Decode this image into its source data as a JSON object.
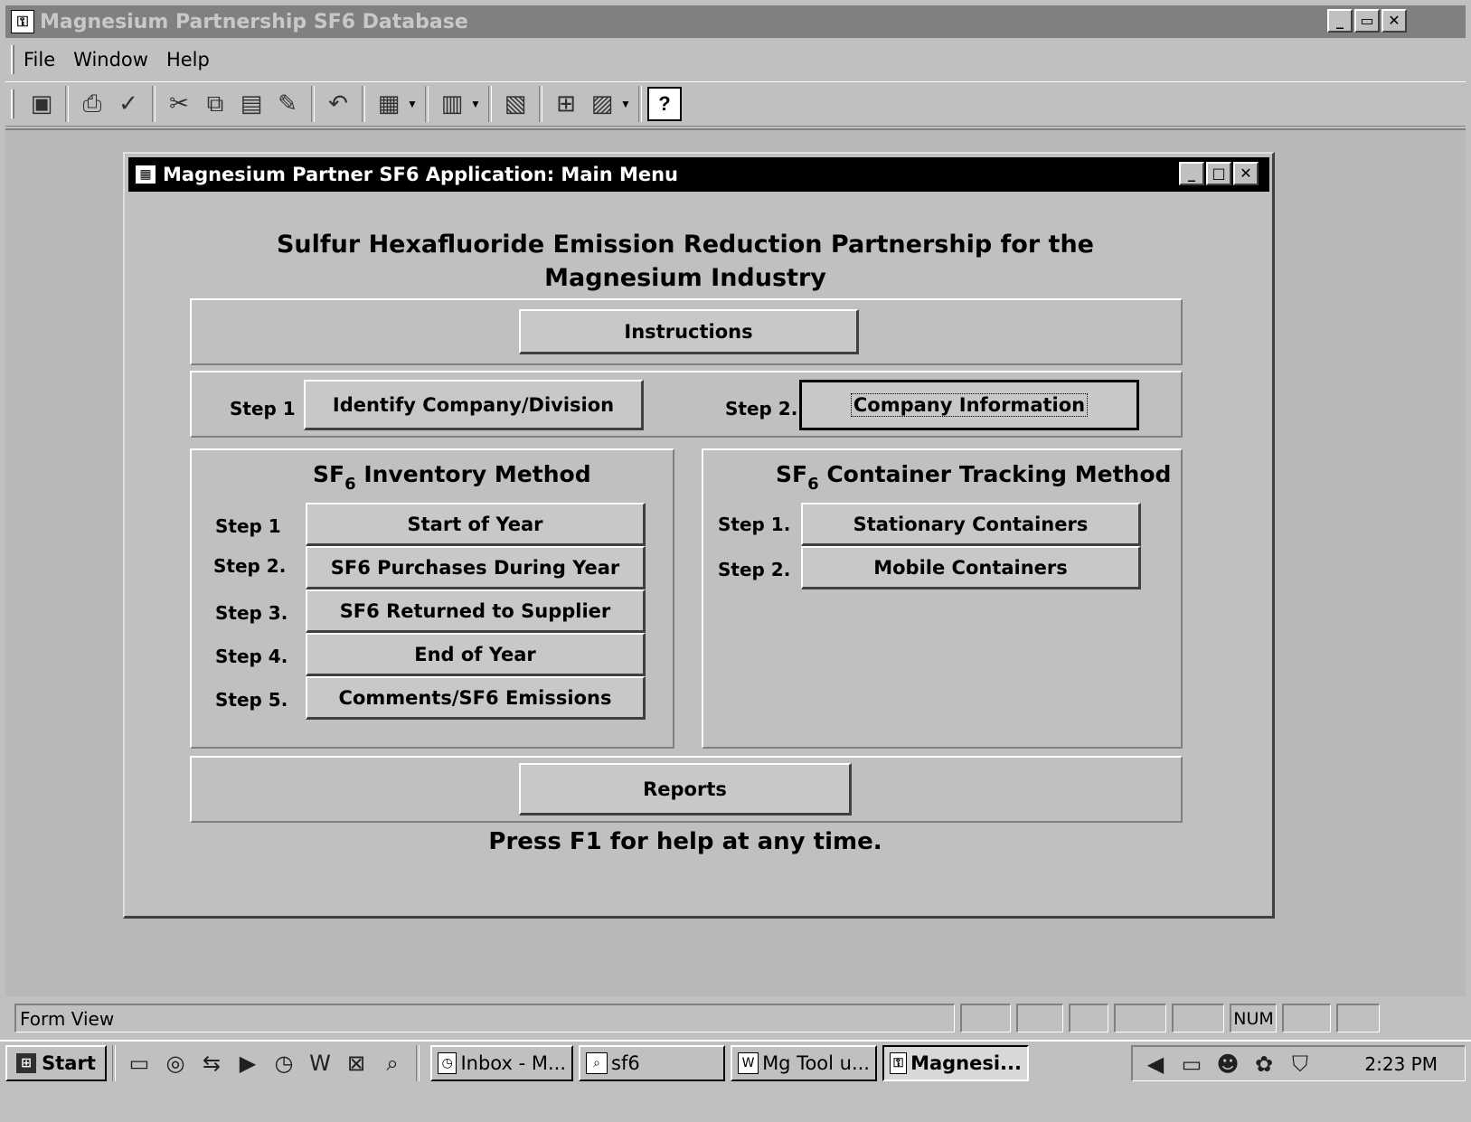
{
  "app": {
    "title": "Magnesium Partnership SF6 Database",
    "min": "_",
    "restore": "▭",
    "close": "✕"
  },
  "menu": {
    "file": "File",
    "window": "Window",
    "help": "Help"
  },
  "toolbar": {
    "icons": [
      "save-icon",
      "print-icon",
      "spelling-icon",
      "cut-icon",
      "copy-icon",
      "paste-icon",
      "format-painter-icon",
      "undo-icon",
      "office-links-icon",
      "analyze-icon",
      "properties-icon",
      "relationships-icon",
      "new-object-icon",
      "help-icon"
    ],
    "help_glyph": "?"
  },
  "form": {
    "title": "Magnesium Partner SF6 Application: Main Menu",
    "heading": "Sulfur Hexafluoride Emission Reduction Partnership for the Magnesium Industry",
    "instructions": "Instructions",
    "step1_label": "Step 1",
    "identify": "Identify Company/Division",
    "step2_label": "Step 2.",
    "company_info": "Company Information",
    "inventory": {
      "title_prefix": "SF",
      "title_sub": "6",
      "title_suffix": " Inventory Method",
      "steps": [
        {
          "label": "Step 1",
          "button": "Start of Year"
        },
        {
          "label": "Step 2.",
          "button": "SF6 Purchases During Year"
        },
        {
          "label": "Step 3.",
          "button": "SF6 Returned to Supplier"
        },
        {
          "label": "Step 4.",
          "button": "End of Year"
        },
        {
          "label": "Step 5.",
          "button": "Comments/SF6 Emissions"
        }
      ]
    },
    "container": {
      "title_prefix": "SF",
      "title_sub": "6",
      "title_suffix": " Container Tracking Method",
      "steps": [
        {
          "label": "Step 1.",
          "button": "Stationary Containers"
        },
        {
          "label": "Step 2.",
          "button": "Mobile Containers"
        }
      ]
    },
    "reports": "Reports",
    "help_note": "Press F1 for help at any time."
  },
  "status": {
    "mode": "Form View",
    "num": "NUM"
  },
  "taskbar": {
    "start": "Start",
    "tasks": [
      {
        "label": "Inbox - M...",
        "icon": "outlook-icon"
      },
      {
        "label": "sf6",
        "icon": "search-folder-icon"
      },
      {
        "label": "Mg Tool u...",
        "icon": "word-icon"
      },
      {
        "label": "Magnesi...",
        "icon": "access-icon"
      }
    ],
    "clock": "2:23 PM"
  }
}
